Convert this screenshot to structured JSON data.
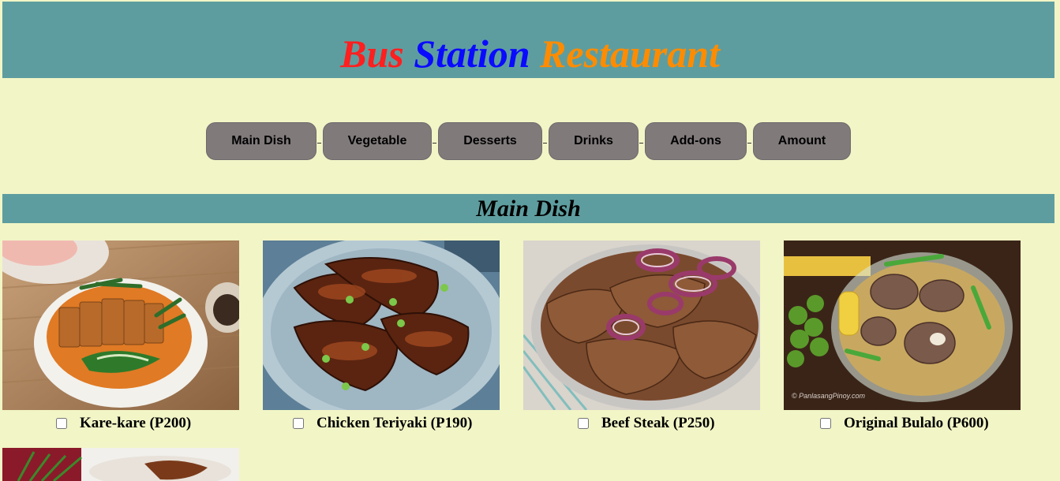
{
  "header": {
    "title_words": [
      {
        "text": "Bus",
        "color": "#ff1f1f"
      },
      {
        "text": "Station",
        "color": "#0a0aff"
      },
      {
        "text": "Restaurant",
        "color": "#ff8c00"
      }
    ]
  },
  "nav": {
    "buttons": [
      "Main Dish",
      "Vegetable",
      "Desserts",
      "Drinks",
      "Add-ons",
      "Amount"
    ]
  },
  "section": {
    "title": "Main Dish"
  },
  "dishes": [
    {
      "label": "Kare-kare (P200)",
      "image": "kare-kare-photo",
      "checked": false
    },
    {
      "label": "Chicken Teriyaki (P190)",
      "image": "chicken-teriyaki-photo",
      "checked": false
    },
    {
      "label": "Beef Steak (P250)",
      "image": "beef-steak-photo",
      "checked": false
    },
    {
      "label": "Original Bulalo (P600)",
      "image": "bulalo-photo",
      "checked": false
    }
  ],
  "colors": {
    "page_background": "#f2f5c6",
    "banner": "#5e9d9f",
    "nav_button": "#807a7b"
  }
}
